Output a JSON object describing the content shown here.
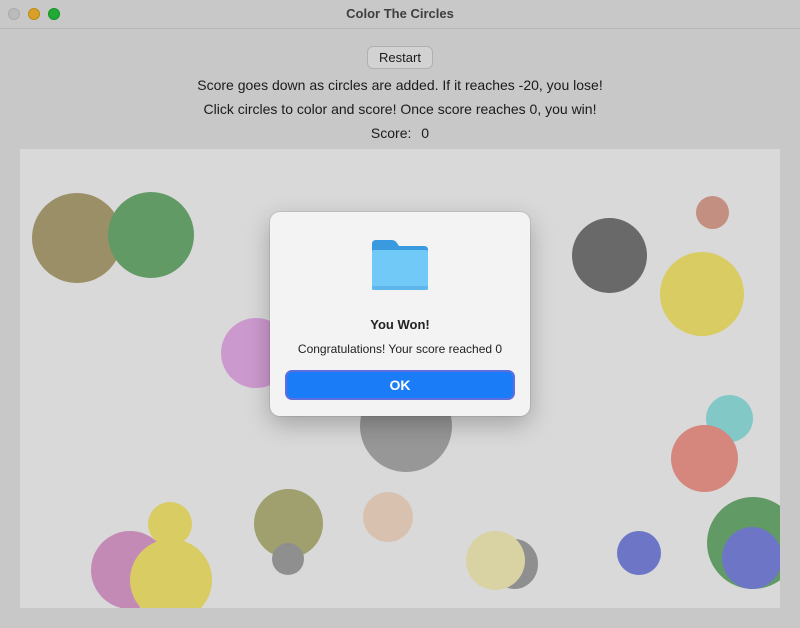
{
  "window": {
    "title": "Color The Circles"
  },
  "controls": {
    "restart_label": "Restart"
  },
  "instructions": {
    "line1": "Score goes down as circles are added. If it reaches -20, you lose!",
    "line2": "Click circles to color and score! Once score reaches 0, you win!"
  },
  "score": {
    "label": "Score:",
    "value": "0"
  },
  "circles": [
    {
      "color": "#b5a878"
    },
    {
      "color": "#74b677"
    },
    {
      "color": "#f0b4f2"
    },
    {
      "color": "#7c7c7c"
    },
    {
      "color": "#e6a898"
    },
    {
      "color": "#fff075"
    },
    {
      "color": "#98ecea"
    },
    {
      "color": "#fb9f95"
    },
    {
      "color": "#b2b2b2"
    },
    {
      "color": "#bdbc82"
    },
    {
      "color": "#ffe3cf"
    },
    {
      "color": "#a9a9a9"
    },
    {
      "color": "#fff7bf"
    },
    {
      "color": "#808be9"
    },
    {
      "color": "#74b677"
    },
    {
      "color": "#808be9"
    },
    {
      "color": "#fff075"
    },
    {
      "color": "#e7a3d6"
    },
    {
      "color": "#fff075"
    },
    {
      "color": "#a9a9a9"
    }
  ],
  "dialog": {
    "icon": "folder-icon",
    "title": "You Won!",
    "message": "Congratulations! Your score reached 0",
    "ok_label": "OK"
  }
}
